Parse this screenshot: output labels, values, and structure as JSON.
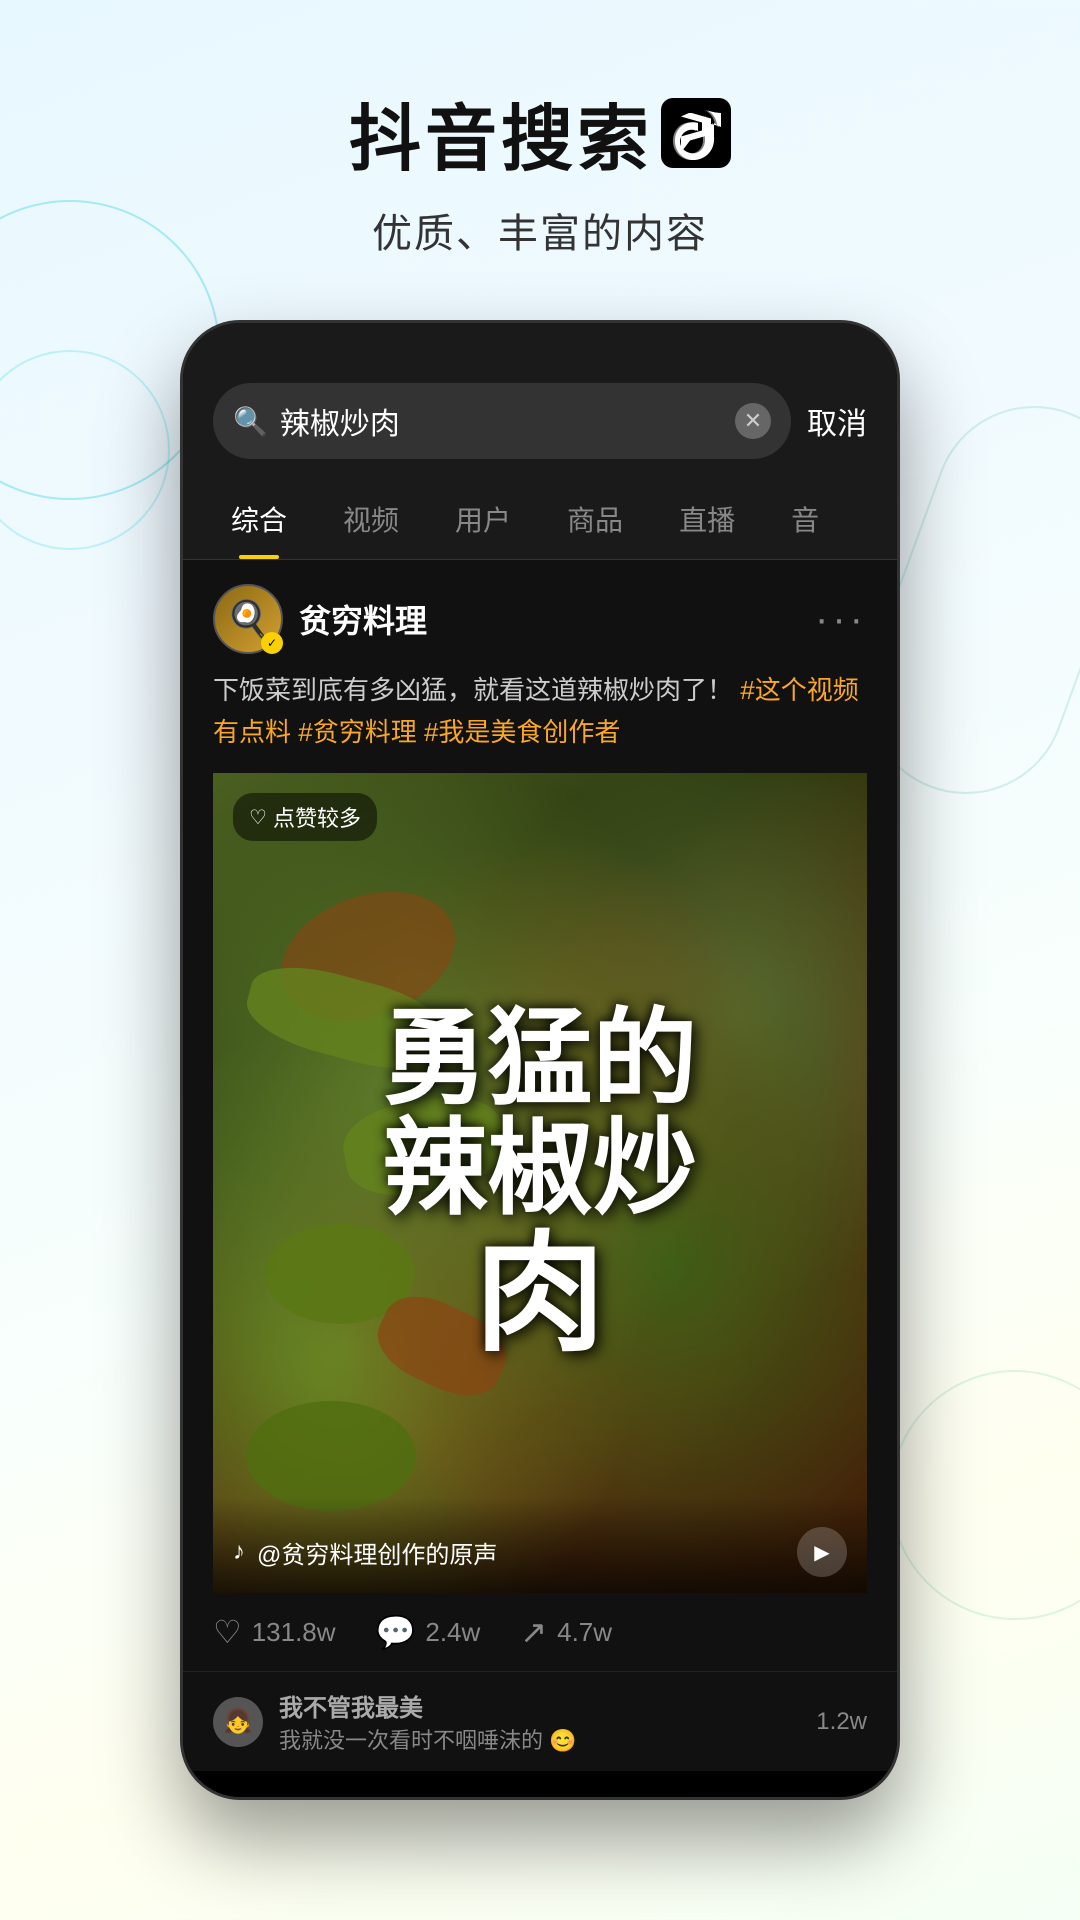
{
  "header": {
    "main_title": "抖音搜索",
    "subtitle": "优质、丰富的内容"
  },
  "search": {
    "query": "辣椒炒肉",
    "cancel_label": "取消"
  },
  "tabs": [
    {
      "label": "综合",
      "active": true
    },
    {
      "label": "视频",
      "active": false
    },
    {
      "label": "用户",
      "active": false
    },
    {
      "label": "商品",
      "active": false
    },
    {
      "label": "直播",
      "active": false
    },
    {
      "label": "音",
      "active": false
    }
  ],
  "post": {
    "username": "贫穷料理",
    "verified": true,
    "text": "下饭菜到底有多凶猛，就看这道辣椒炒肉了！",
    "hashtags": [
      "#这个视频有点料",
      "#贫穷料理",
      "#我是美食创作者"
    ],
    "video_label": "点赞较多",
    "video_big_text": "勇猛的辣椒炒肉",
    "audio_text": "@贫穷料理创作的原声",
    "likes": "131.8w",
    "comments": "2.4w",
    "shares": "4.7w"
  },
  "comment": {
    "username": "我不管我最美",
    "text": "我就没一次看时不咽唾沫的 😊",
    "likes": "1.2w"
  }
}
